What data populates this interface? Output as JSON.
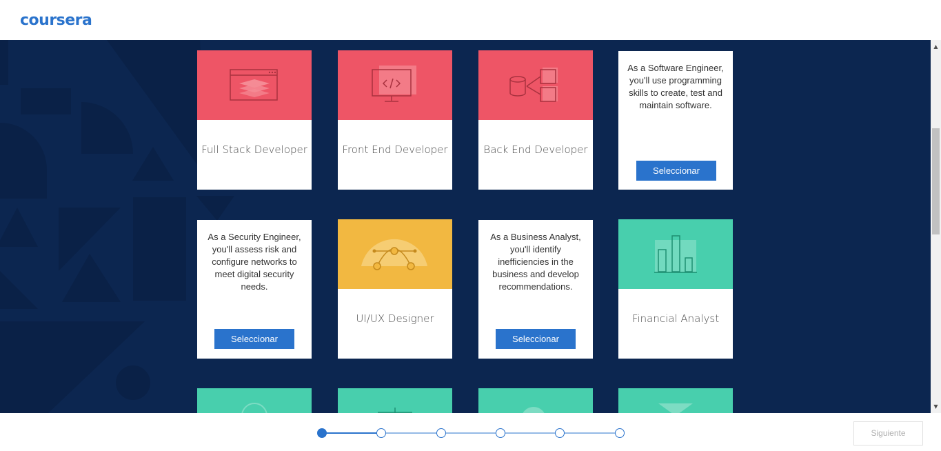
{
  "header": {
    "logo_text": "coursera"
  },
  "cards": [
    {
      "title": "Full Stack Developer",
      "icon": "browser-layers-icon",
      "color": "#ee5566"
    },
    {
      "title": "Front End Developer",
      "icon": "code-monitor-icon",
      "color": "#ee5566"
    },
    {
      "title": "Back End Developer",
      "icon": "database-server-icon",
      "color": "#ee5566"
    },
    {
      "description": "As a Software Engineer, you'll use programming skills to create, test and maintain software.",
      "button": "Seleccionar"
    },
    {
      "description": "As a Security Engineer, you'll assess risk and configure networks to meet digital security needs.",
      "button": "Seleccionar"
    },
    {
      "title": "UI/UX Designer",
      "icon": "bezier-curve-icon",
      "color": "#f2b841"
    },
    {
      "description": "As a Business Analyst, you'll identify inefficiencies in the business and develop recommendations.",
      "button": "Seleccionar"
    },
    {
      "title": "Financial Analyst",
      "icon": "bar-chart-icon",
      "color": "#48cfad"
    }
  ],
  "colors": {
    "accent": "#2a73cc",
    "background": "#0c2650",
    "teal": "#48cfad"
  },
  "progress": {
    "total_steps": 6,
    "current_step": 1
  },
  "footer": {
    "next_label": "Siguiente"
  }
}
